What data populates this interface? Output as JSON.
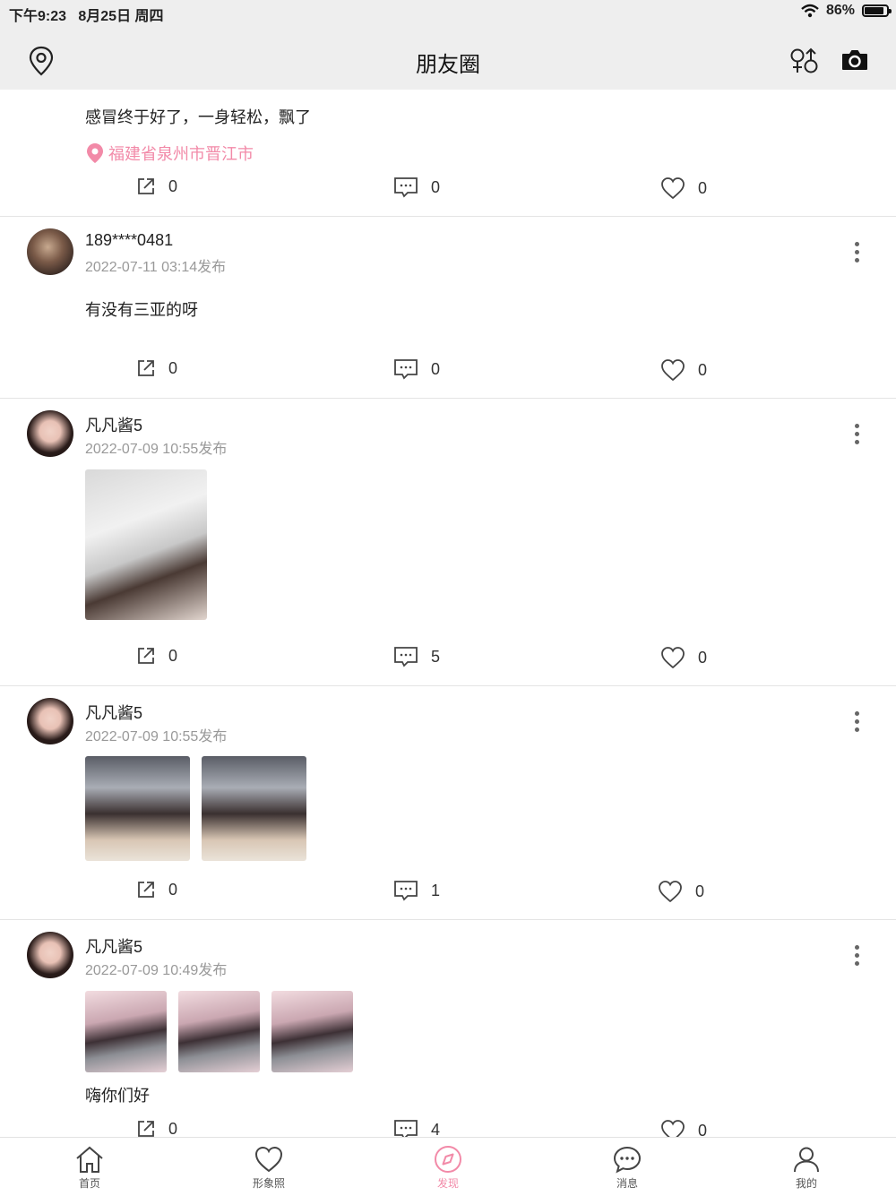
{
  "status_bar": {
    "time": "下午9:23",
    "date": "8月25日 周四",
    "battery": "86%",
    "battery_level": 0.86
  },
  "header": {
    "title": "朋友圈",
    "left_icon": "location-pin-icon",
    "right_icons": [
      "gender-filter-icon",
      "camera-icon"
    ]
  },
  "posts": [
    {
      "text": "感冒终于好了，一身轻松，飘了",
      "location": "福建省泉州市晋江市",
      "shares": "0",
      "comments": "0",
      "likes": "0"
    },
    {
      "user": "189****0481",
      "time": "2022-07-11 03:14发布",
      "text": "有没有三亚的呀",
      "shares": "0",
      "comments": "0",
      "likes": "0"
    },
    {
      "user": "凡凡酱5",
      "time": "2022-07-09 10:55发布",
      "shares": "0",
      "comments": "5",
      "likes": "0"
    },
    {
      "user": "凡凡酱5",
      "time": "2022-07-09 10:55发布",
      "shares": "0",
      "comments": "1",
      "likes": "0"
    },
    {
      "user": "凡凡酱5",
      "time": "2022-07-09 10:49发布",
      "text": "嗨你们好",
      "shares": "0",
      "comments": "4",
      "likes": "0"
    }
  ],
  "tabs": [
    {
      "label": "首页",
      "icon": "home-icon"
    },
    {
      "label": "形象照",
      "icon": "heart-icon"
    },
    {
      "label": "发现",
      "icon": "compass-icon",
      "active": true
    },
    {
      "label": "消息",
      "icon": "chat-bubble-icon"
    },
    {
      "label": "我的",
      "icon": "user-icon"
    }
  ],
  "colors": {
    "accent": "#f28aa8",
    "header_bg": "#eeeeee",
    "divider": "#e4e4e4"
  }
}
